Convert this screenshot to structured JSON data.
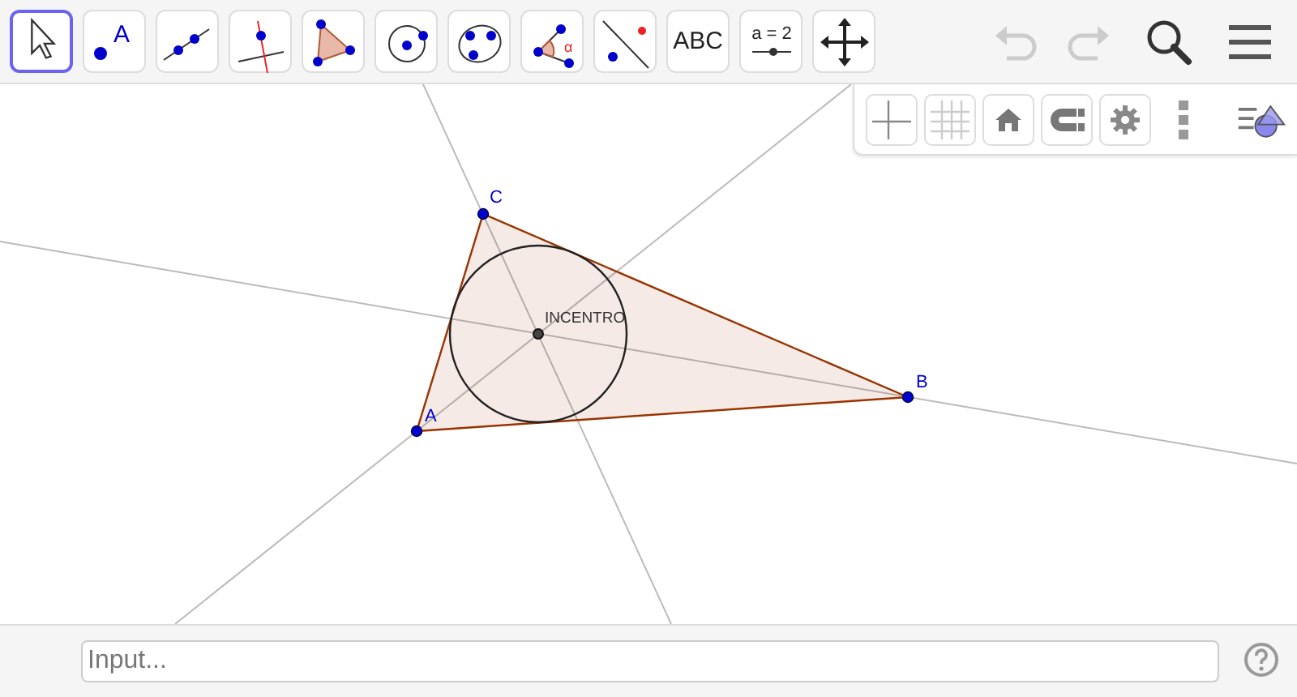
{
  "toolbar": {
    "tools": [
      {
        "kind": "move",
        "selected": true
      },
      {
        "kind": "point",
        "selected": false,
        "label": "A"
      },
      {
        "kind": "line",
        "selected": false
      },
      {
        "kind": "perpendicular",
        "selected": false
      },
      {
        "kind": "polygon",
        "selected": false
      },
      {
        "kind": "circle",
        "selected": false
      },
      {
        "kind": "ellipse",
        "selected": false
      },
      {
        "kind": "angle",
        "selected": false,
        "label": "α"
      },
      {
        "kind": "reflect",
        "selected": false
      },
      {
        "kind": "text",
        "selected": false,
        "label": "ABC"
      },
      {
        "kind": "slider",
        "selected": false,
        "label": "a = 2"
      },
      {
        "kind": "pan",
        "selected": false
      }
    ],
    "undo": {
      "disabled": true
    },
    "redo": {
      "disabled": true
    }
  },
  "style_bar": {
    "axes": {
      "on": false
    },
    "grid": {
      "on": false
    }
  },
  "graphics": {
    "points": [
      {
        "label": "A"
      },
      {
        "label": "B"
      },
      {
        "label": "C"
      }
    ],
    "incenter": {
      "label": "INCENTRO"
    }
  },
  "input_bar": {
    "placeholder": "Input..."
  }
}
